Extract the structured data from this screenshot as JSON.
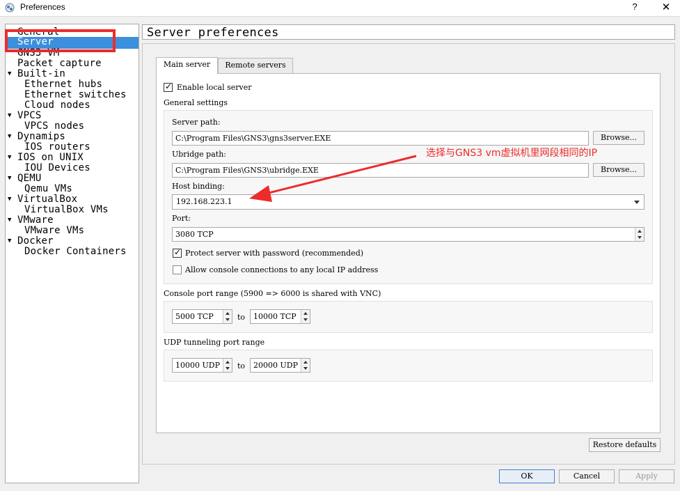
{
  "window": {
    "title": "Preferences",
    "help_label": "?",
    "close_label": "✕"
  },
  "tree": [
    {
      "label": "General",
      "indent": 0,
      "arrow": false
    },
    {
      "label": "Server",
      "indent": 0,
      "arrow": false,
      "selected": true
    },
    {
      "label": "GNS3 VM",
      "indent": 0,
      "arrow": false
    },
    {
      "label": "Packet capture",
      "indent": 0,
      "arrow": false
    },
    {
      "label": "Built-in",
      "indent": 0,
      "arrow": true
    },
    {
      "label": "Ethernet hubs",
      "indent": 1,
      "arrow": false
    },
    {
      "label": "Ethernet switches",
      "indent": 1,
      "arrow": false
    },
    {
      "label": "Cloud nodes",
      "indent": 1,
      "arrow": false
    },
    {
      "label": "VPCS",
      "indent": 0,
      "arrow": true
    },
    {
      "label": "VPCS nodes",
      "indent": 1,
      "arrow": false
    },
    {
      "label": "Dynamips",
      "indent": 0,
      "arrow": true
    },
    {
      "label": "IOS routers",
      "indent": 1,
      "arrow": false
    },
    {
      "label": "IOS on UNIX",
      "indent": 0,
      "arrow": true
    },
    {
      "label": "IOU Devices",
      "indent": 1,
      "arrow": false
    },
    {
      "label": "QEMU",
      "indent": 0,
      "arrow": true
    },
    {
      "label": "Qemu VMs",
      "indent": 1,
      "arrow": false
    },
    {
      "label": "VirtualBox",
      "indent": 0,
      "arrow": true
    },
    {
      "label": "VirtualBox VMs",
      "indent": 1,
      "arrow": false
    },
    {
      "label": "VMware",
      "indent": 0,
      "arrow": true
    },
    {
      "label": "VMware VMs",
      "indent": 1,
      "arrow": false
    },
    {
      "label": "Docker",
      "indent": 0,
      "arrow": true
    },
    {
      "label": "Docker Containers",
      "indent": 1,
      "arrow": false
    }
  ],
  "pane": {
    "title": "Server preferences"
  },
  "tabs": {
    "main": "Main server",
    "remote": "Remote servers"
  },
  "main": {
    "enable_local_server": "Enable local server",
    "general_settings": "General settings",
    "server_path_label": "Server path:",
    "server_path_value": "C:\\Program Files\\GNS3\\gns3server.EXE",
    "browse_label": "Browse...",
    "ubridge_path_label": "Ubridge path:",
    "ubridge_path_value": "C:\\Program Files\\GNS3\\ubridge.EXE",
    "host_binding_label": "Host binding:",
    "host_binding_value": "192.168.223.1",
    "port_label": "Port:",
    "port_value": "3080 TCP",
    "protect_label": "Protect server with password (recommended)",
    "allow_console_label": "Allow console connections to any local IP address",
    "console_range_label": "Console port range (5900 => 6000 is shared with VNC)",
    "console_from": "5000 TCP",
    "console_to": "10000 TCP",
    "to_label": "to",
    "udp_range_label": "UDP tunneling port range",
    "udp_from": "10000 UDP",
    "udp_to": "20000 UDP"
  },
  "buttons": {
    "restore": "Restore defaults",
    "ok": "OK",
    "cancel": "Cancel",
    "apply": "Apply"
  },
  "annotation": {
    "text": "选择与GNS3 vm虚拟机里网段相同的IP",
    "color": "#ee2b2b"
  },
  "colors": {
    "selection": "#3c8fdc",
    "highlight_border": "#ee2b2b"
  },
  "checkboxes": {
    "enable_local_server": true,
    "protect_server": true,
    "allow_console": false
  }
}
